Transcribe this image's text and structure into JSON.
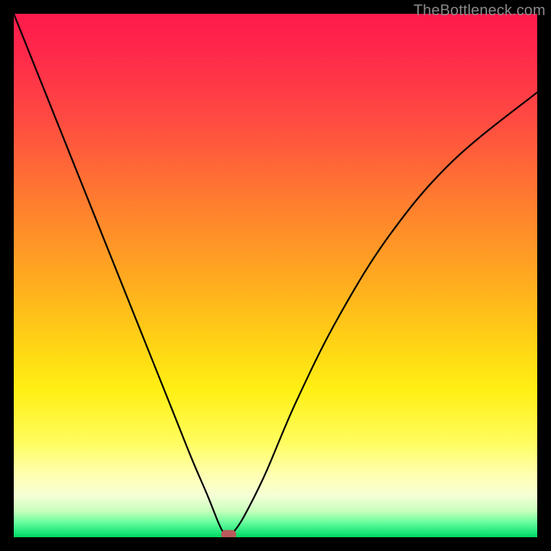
{
  "watermark": "TheBottleneck.com",
  "chart_data": {
    "type": "line",
    "title": "",
    "xlabel": "",
    "ylabel": "",
    "xlim": [
      0,
      100
    ],
    "ylim": [
      0,
      100
    ],
    "series": [
      {
        "name": "curve",
        "x": [
          0,
          6,
          12,
          18,
          24,
          30,
          34,
          37,
          39,
          40,
          41,
          42,
          44,
          48,
          54,
          62,
          72,
          84,
          100
        ],
        "values": [
          100,
          85,
          70,
          55,
          40,
          25,
          15,
          8,
          3,
          1,
          0,
          1,
          4,
          12,
          26,
          42,
          58,
          72,
          85
        ]
      }
    ],
    "marker": {
      "x": 41,
      "y": 0
    }
  },
  "colors": {
    "curve": "#000000",
    "marker": "#b95a5a",
    "background_top": "#ff1a4d",
    "background_bottom": "#00d860",
    "frame": "#000000"
  }
}
